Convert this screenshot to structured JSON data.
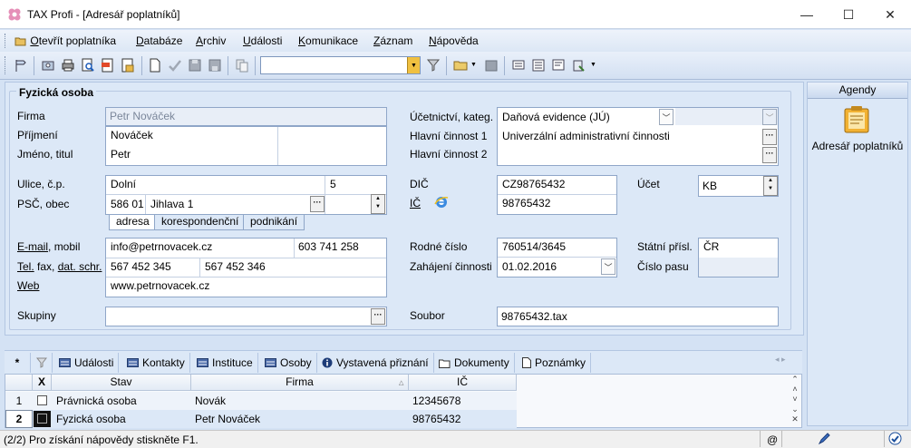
{
  "window": {
    "title": "TAX Profi - [Adresář poplatníků]",
    "minimize": "—",
    "maximize": "☐",
    "close": "✕"
  },
  "menu": [
    {
      "label": "Otevřít poplatníka",
      "u": "O",
      "rest": "tevřít poplatníka"
    },
    {
      "label": "Databáze",
      "u": "D",
      "rest": "atabáze"
    },
    {
      "label": "Archiv",
      "u": "A",
      "rest": "rchiv"
    },
    {
      "label": "Události",
      "u": "U",
      "rest": "dálosti"
    },
    {
      "label": "Komunikace",
      "u": "K",
      "rest": "omunikace"
    },
    {
      "label": "Záznam",
      "u": "Z",
      "rest": "áznam"
    },
    {
      "label": "Nápověda",
      "u": "N",
      "rest": "ápověda"
    }
  ],
  "toolbar": {
    "combo_value": ""
  },
  "form": {
    "section_title": "Fyzická osoba",
    "labels": {
      "firma": "Firma",
      "prijmeni": "Příjmení",
      "jmeno": "Jméno, titul",
      "ulice": "Ulice, č.p.",
      "psc": "PSČ, obec",
      "email": "E-mail",
      "mobil": "mobil",
      "tel": "Tel.",
      "fax": "fax,",
      "datschr": "dat. schr.",
      "web": "Web",
      "skupiny": "Skupiny",
      "ucetnictvi": "Účetnictví, kateg.",
      "hlavni1": "Hlavní činnost 1",
      "hlavni2": "Hlavní činnost 2",
      "dic": "DIČ",
      "ic": "IČ",
      "ucet": "Účet",
      "rodne": "Rodné číslo",
      "zahajeni": "Zahájení činnosti",
      "statni": "Státní přísl.",
      "cislopasu": "Číslo pasu",
      "soubor": "Soubor"
    },
    "values": {
      "firma": "Petr Nováček",
      "prijmeni": "Nováček",
      "jmeno": "Petr",
      "ulice": "Dolní",
      "cp": "5",
      "psc": "586 01",
      "obec": "Jihlava 1",
      "email": "info@petrnovacek.cz",
      "mobil": "603 741 258",
      "tel": "567 452 345",
      "fax": "567 452 346",
      "web": "www.petrnovacek.cz",
      "skupiny": "",
      "ucetnictvi": "Daňová evidence (JÚ)",
      "hlavni1": "Univerzální administrativní činnosti",
      "dic": "CZ98765432",
      "ic": "98765432",
      "ucet": "KB",
      "rodne": "760514/3645",
      "zahajeni": "01.02.2016",
      "statni": "ČR",
      "cislopasu": "",
      "soubor": "98765432.tax"
    },
    "address_tabs": [
      "adresa",
      "korespondenční",
      "podnikání"
    ]
  },
  "agendy": {
    "title": "Agendy",
    "item": "Adresář poplatníků"
  },
  "bottom_tabs": [
    {
      "label": "*"
    },
    {
      "label": ""
    },
    {
      "label": "Události"
    },
    {
      "label": "Kontakty"
    },
    {
      "label": "Instituce"
    },
    {
      "label": "Osoby"
    },
    {
      "label": "Vystavená přiznání"
    },
    {
      "label": "Dokumenty"
    },
    {
      "label": "Poznámky"
    }
  ],
  "grid": {
    "columns": [
      "X",
      "Stav",
      "Firma",
      "IČ"
    ],
    "rows": [
      {
        "num": "1",
        "stav": "Právnická osoba",
        "firma": "Novák",
        "ic": "12345678"
      },
      {
        "num": "2",
        "stav": "Fyzická osoba",
        "firma": "Petr Nováček",
        "ic": "98765432"
      }
    ]
  },
  "status": {
    "text": "(2/2)  Pro získání nápovědy stiskněte F1.",
    "at": "@"
  }
}
